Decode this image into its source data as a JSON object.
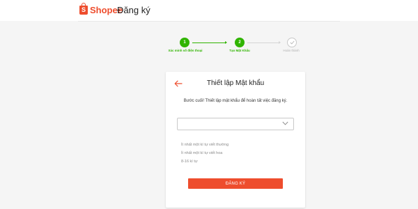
{
  "header": {
    "logo_text": "Shopee",
    "page_title": "Đăng ký"
  },
  "stepper": {
    "steps": [
      {
        "number": "1",
        "label": "Xác minh số điện thoại",
        "status": "completed"
      },
      {
        "number": "2",
        "label": "Tạo Mật Khẩu",
        "status": "current"
      },
      {
        "number": "",
        "label": "Hoàn thành",
        "status": "pending"
      }
    ],
    "active_color": "#30b400",
    "inactive_color": "#c8c8c8"
  },
  "card": {
    "title": "Thiết lập Mật khẩu",
    "description": "Bước cuối! Thiết lập mật khẩu để hoàn tất việc đăng ký.",
    "password_field": {
      "value": "",
      "placeholder": ""
    },
    "rules": [
      "Ít nhất một kí tự viết thường",
      "Ít nhất một kí tự viết hoa",
      "8-16 kí tự"
    ],
    "submit_label": "ĐĂNG KÝ"
  },
  "colors": {
    "brand": "#ee4d2d",
    "background": "#f5f5f5"
  },
  "icons": {
    "logo": "shopee-bag-icon",
    "back": "arrow-left-icon",
    "dropdown": "chevron-down-icon",
    "done": "check-icon"
  }
}
